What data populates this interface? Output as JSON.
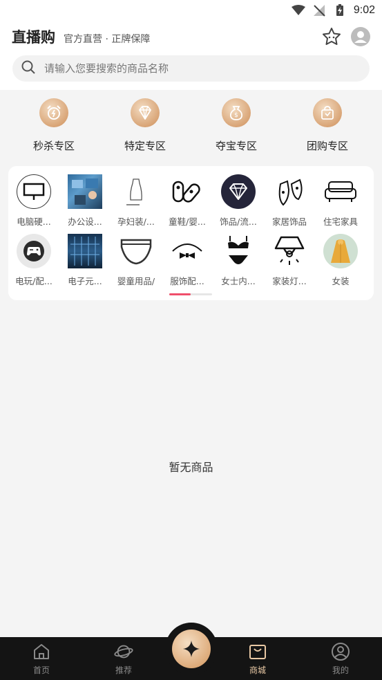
{
  "status_bar": {
    "time": "9:02"
  },
  "header": {
    "title": "直播购",
    "subtitle": "官方直营 · 正牌保障"
  },
  "search": {
    "placeholder": "请输入您要搜索的商品名称"
  },
  "zones": [
    {
      "label": "秒杀专区",
      "icon": "alarm-clock-icon"
    },
    {
      "label": "特定专区",
      "icon": "diamond-icon"
    },
    {
      "label": "夺宝专区",
      "icon": "money-bag-icon"
    },
    {
      "label": "团购专区",
      "icon": "shopping-bag-icon"
    }
  ],
  "categories": [
    {
      "label": "电脑硬..."
    },
    {
      "label": "办公设..."
    },
    {
      "label": "孕妇装/..."
    },
    {
      "label": "童鞋/婴..."
    },
    {
      "label": "饰品/流..."
    },
    {
      "label": "家居饰品"
    },
    {
      "label": "住宅家具"
    },
    {
      "label": "电玩/配..."
    },
    {
      "label": "电子元..."
    },
    {
      "label": "婴童用品/"
    },
    {
      "label": "服饰配..."
    },
    {
      "label": "女士内..."
    },
    {
      "label": "家装灯..."
    },
    {
      "label": "女装"
    }
  ],
  "pager": {
    "pages": 2,
    "current": 1
  },
  "empty_message": "暂无商品",
  "bottom_nav": {
    "items": [
      {
        "label": "首页",
        "icon": "home-icon"
      },
      {
        "label": "推荐",
        "icon": "planet-icon"
      },
      {
        "label": "商城",
        "icon": "shopping-bag-icon"
      },
      {
        "label": "我的",
        "icon": "user-icon"
      }
    ],
    "active": "商城"
  },
  "colors": {
    "accent_gold": "#d9a577",
    "pager_active": "#ef4f6b",
    "nav_bg": "#141414"
  }
}
